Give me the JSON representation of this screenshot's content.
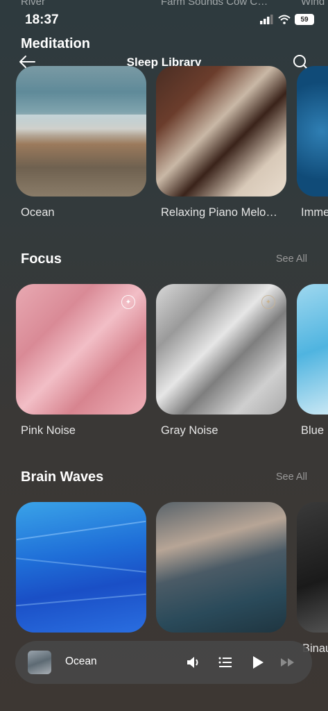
{
  "background_hints": {
    "top_left": "River",
    "top_center": "Farm Sounds Cow C…",
    "top_right": "Wind"
  },
  "status_bar": {
    "time": "18:37",
    "battery": "59"
  },
  "header": {
    "subtitle": "Meditation",
    "title": "Sleep Library"
  },
  "rows": {
    "top": {
      "items": [
        {
          "label": "Ocean"
        },
        {
          "label": "Relaxing Piano Melo…"
        },
        {
          "label": "Imme"
        }
      ]
    },
    "focus": {
      "title": "Focus",
      "see_all": "See All",
      "items": [
        {
          "label": "Pink Noise"
        },
        {
          "label": "Gray Noise"
        },
        {
          "label": "Blue"
        }
      ]
    },
    "brain_waves": {
      "title": "Brain Waves",
      "see_all": "See All",
      "items": [
        {
          "label": ""
        },
        {
          "label": ""
        },
        {
          "label": "Binau"
        }
      ]
    }
  },
  "player": {
    "title": "Ocean"
  },
  "colors": {
    "accent": "#ffffff",
    "see_all": "#9a9a9a",
    "player_bg": "#464646"
  }
}
